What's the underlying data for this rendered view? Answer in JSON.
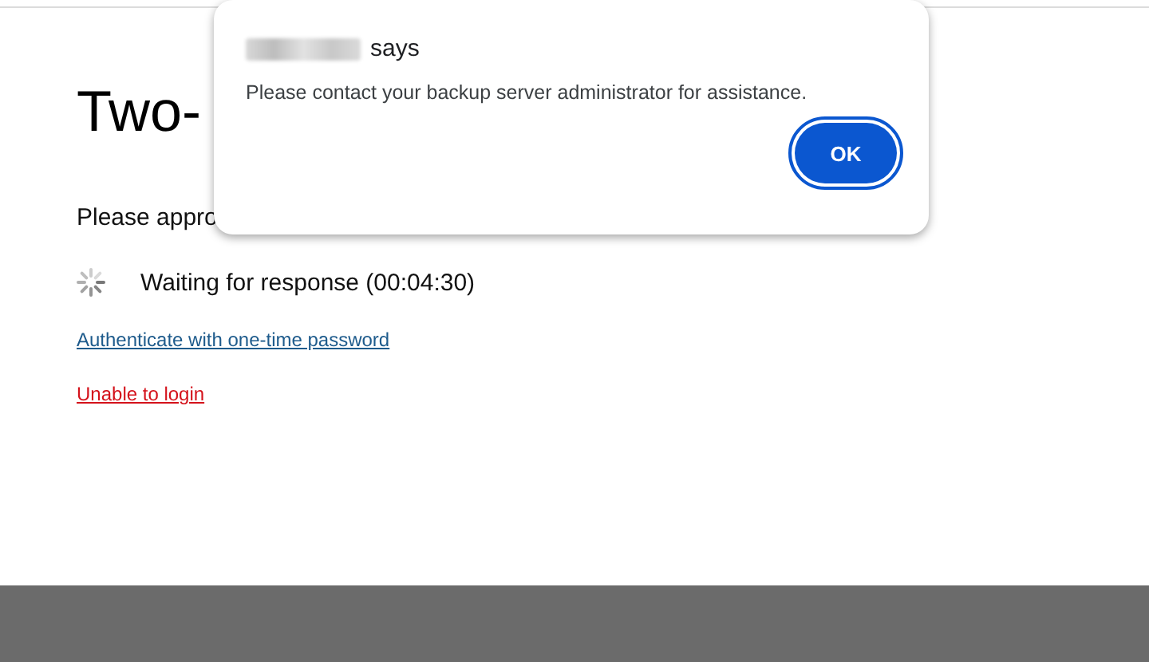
{
  "page": {
    "heading": "Two-",
    "instruction": "Please appro",
    "status": "Waiting for response (00:04:30)",
    "links": [
      {
        "kind": "primary",
        "text": "Authenticate with one-time password"
      },
      {
        "kind": "danger",
        "text": "Unable to login"
      }
    ]
  },
  "dialog": {
    "title": "says",
    "message": "Please contact your backup server administrator for assistance.",
    "button": "OK"
  }
}
